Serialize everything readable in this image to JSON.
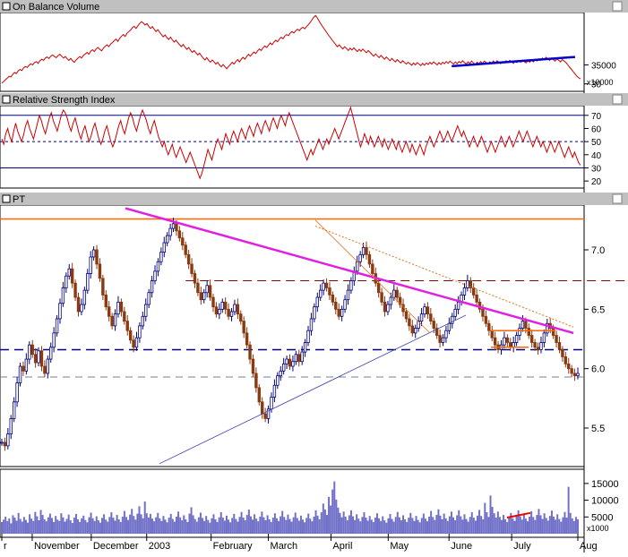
{
  "panels": {
    "obv": {
      "title": "On Balance Volume",
      "ticks": [
        {
          "v": 35000,
          "label": "35000"
        },
        {
          "v": 30000,
          "label": "30"
        }
      ],
      "scale_label": "x10000"
    },
    "rsi": {
      "title": "Relative Strength Index",
      "ticks": [
        {
          "v": 70,
          "label": "70"
        },
        {
          "v": 60,
          "label": "60"
        },
        {
          "v": 50,
          "label": "50"
        },
        {
          "v": 40,
          "label": "40"
        },
        {
          "v": 30,
          "label": "30"
        },
        {
          "v": 20,
          "label": "20"
        }
      ]
    },
    "price": {
      "title": "PT",
      "ticks": [
        {
          "v": 7.0,
          "label": "7.0"
        },
        {
          "v": 6.5,
          "label": "6.5"
        },
        {
          "v": 6.0,
          "label": "6.0"
        },
        {
          "v": 5.5,
          "label": "5.5"
        }
      ]
    },
    "volume": {
      "ticks": [
        {
          "v": 15000,
          "label": "15000"
        },
        {
          "v": 10000,
          "label": "10000"
        },
        {
          "v": 5000,
          "label": "5000"
        }
      ],
      "scale_label": "x1000"
    }
  },
  "x_axis": {
    "labels": [
      {
        "text": "r",
        "i": 0
      },
      {
        "text": "November",
        "i": 17
      },
      {
        "text": "December",
        "i": 50
      },
      {
        "text": "2003",
        "i": 81
      },
      {
        "text": "February",
        "i": 117
      },
      {
        "text": "March",
        "i": 149
      },
      {
        "text": "April",
        "i": 184
      },
      {
        "text": "May",
        "i": 216
      },
      {
        "text": "June",
        "i": 250
      },
      {
        "text": "July",
        "i": 285
      },
      {
        "text": "Aug",
        "i": 322
      }
    ]
  },
  "chart_data": {
    "type": "line",
    "series": [
      {
        "name": "On Balance Volume",
        "values": [
          30.2,
          30.6,
          31.1,
          31.5,
          32.0,
          31.8,
          32.5,
          33.0,
          32.7,
          33.4,
          33.8,
          33.5,
          34.2,
          34.6,
          34.3,
          34.9,
          35.3,
          35.0,
          35.6,
          35.9,
          35.4,
          36.1,
          36.5,
          36.2,
          36.8,
          37.1,
          36.7,
          37.3,
          37.6,
          37.2,
          36.9,
          37.4,
          37.8,
          37.3,
          36.8,
          37.2,
          36.6,
          36.2,
          36.7,
          36.1,
          35.7,
          36.3,
          36.8,
          37.2,
          36.8,
          37.5,
          37.9,
          38.3,
          37.8,
          38.6,
          39.0,
          38.5,
          39.2,
          39.6,
          39.1,
          38.7,
          39.4,
          39.9,
          40.3,
          39.8,
          40.5,
          40.9,
          41.4,
          41.8,
          41.2,
          42.0,
          42.6,
          43.0,
          42.5,
          43.3,
          43.8,
          44.2,
          44.8,
          45.2,
          44.6,
          45.3,
          45.9,
          46.4,
          46.0,
          45.5,
          45.9,
          45.2,
          44.6,
          45.1,
          44.4,
          43.8,
          44.3,
          43.6,
          43.0,
          42.4,
          42.9,
          42.2,
          41.7,
          42.3,
          41.6,
          41.0,
          41.5,
          40.9,
          40.3,
          39.8,
          40.4,
          39.7,
          39.1,
          39.6,
          38.9,
          38.3,
          38.8,
          38.2,
          37.6,
          38.1,
          37.4,
          36.8,
          36.3,
          36.9,
          36.2,
          35.7,
          36.3,
          35.8,
          35.2,
          35.7,
          35.0,
          34.5,
          35.1,
          34.5,
          34.0,
          34.6,
          35.1,
          35.7,
          35.2,
          35.9,
          36.4,
          35.8,
          36.5,
          37.0,
          36.5,
          37.2,
          37.8,
          37.3,
          37.9,
          38.4,
          38.0,
          38.7,
          39.2,
          38.8,
          39.5,
          40.0,
          39.6,
          40.2,
          40.8,
          40.3,
          41.0,
          41.5,
          41.1,
          41.8,
          42.3,
          41.9,
          42.6,
          43.0,
          42.7,
          43.4,
          43.8,
          43.4,
          44.0,
          44.4,
          44.0,
          44.6,
          44.9,
          44.5,
          45.1,
          45.6,
          46.2,
          46.9,
          47.6,
          48.0,
          47.3,
          46.5,
          45.7,
          45.0,
          44.3,
          43.6,
          42.9,
          42.3,
          41.6,
          41.0,
          40.4,
          39.8,
          40.3,
          39.7,
          39.2,
          39.8,
          39.3,
          38.8,
          39.4,
          38.9,
          39.5,
          39.0,
          38.5,
          39.1,
          38.6,
          39.2,
          38.7,
          38.2,
          38.8,
          38.3,
          37.8,
          37.3,
          37.9,
          37.4,
          36.9,
          37.5,
          37.0,
          36.5,
          37.1,
          36.6,
          36.1,
          36.7,
          36.2,
          35.8,
          36.4,
          35.9,
          35.5,
          36.1,
          35.6,
          35.2,
          35.7,
          35.3,
          34.9,
          35.5,
          35.0,
          35.6,
          35.2,
          34.8,
          35.4,
          34.9,
          35.5,
          35.1,
          35.7,
          35.2,
          35.8,
          35.4,
          35.0,
          35.6,
          35.1,
          35.7,
          35.3,
          35.9,
          35.4,
          36.0,
          35.6,
          35.2,
          35.8,
          35.3,
          35.9,
          35.5,
          36.1,
          35.6,
          35.2,
          35.8,
          35.4,
          36.0,
          35.5,
          35.1,
          35.7,
          35.3,
          35.9,
          35.4,
          36.0,
          35.6,
          35.2,
          35.8,
          35.4,
          36.0,
          35.5,
          36.1,
          35.7,
          35.3,
          35.9,
          35.5,
          36.1,
          35.6,
          36.2,
          35.8,
          35.4,
          36.0,
          35.6,
          36.2,
          35.7,
          36.3,
          35.9,
          35.5,
          36.1,
          35.7,
          36.3,
          35.8,
          36.4,
          36.0,
          36.6,
          36.2,
          36.8,
          36.4,
          37.0,
          36.6,
          36.2,
          36.8,
          36.4,
          36.0,
          36.6,
          36.2,
          35.8,
          36.4,
          36.0,
          35.6,
          35.0,
          34.4,
          33.8,
          33.2,
          32.6,
          32.0,
          31.6,
          31.3
        ]
      },
      {
        "name": "Relative Strength Index",
        "values": [
          52,
          48,
          56,
          60,
          54,
          50,
          58,
          64,
          58,
          54,
          50,
          55,
          62,
          66,
          60,
          56,
          52,
          58,
          64,
          70,
          66,
          60,
          56,
          62,
          68,
          72,
          66,
          62,
          58,
          64,
          70,
          74,
          72,
          68,
          62,
          58,
          64,
          68,
          62,
          56,
          52,
          58,
          62,
          56,
          50,
          54,
          60,
          64,
          58,
          52,
          48,
          52,
          58,
          62,
          56,
          50,
          46,
          50,
          56,
          62,
          66,
          60,
          56,
          62,
          68,
          72,
          68,
          62,
          58,
          64,
          70,
          74,
          70,
          66,
          60,
          56,
          62,
          66,
          60,
          54,
          50,
          46,
          50,
          44,
          40,
          44,
          48,
          42,
          38,
          42,
          46,
          42,
          38,
          34,
          38,
          42,
          38,
          34,
          30,
          26,
          22,
          26,
          32,
          38,
          44,
          40,
          36,
          42,
          48,
          52,
          48,
          44,
          50,
          56,
          52,
          48,
          54,
          58,
          54,
          50,
          56,
          60,
          56,
          52,
          58,
          62,
          58,
          54,
          60,
          64,
          60,
          56,
          62,
          66,
          62,
          58,
          64,
          68,
          64,
          60,
          66,
          70,
          66,
          62,
          68,
          72,
          68,
          64,
          60,
          56,
          52,
          48,
          44,
          40,
          36,
          40,
          44,
          40,
          44,
          48,
          52,
          48,
          44,
          48,
          52,
          48,
          52,
          56,
          60,
          56,
          52,
          56,
          60,
          64,
          68,
          72,
          76,
          70,
          64,
          58,
          52,
          46,
          50,
          56,
          52,
          48,
          54,
          50,
          46,
          50,
          54,
          50,
          46,
          52,
          48,
          44,
          48,
          52,
          48,
          44,
          50,
          46,
          42,
          46,
          50,
          46,
          42,
          48,
          44,
          40,
          44,
          48,
          44,
          40,
          46,
          50,
          54,
          50,
          46,
          50,
          54,
          58,
          54,
          50,
          54,
          58,
          54,
          50,
          54,
          58,
          62,
          58,
          54,
          58,
          54,
          50,
          46,
          50,
          54,
          50,
          46,
          50,
          54,
          50,
          46,
          42,
          46,
          50,
          46,
          42,
          46,
          50,
          54,
          50,
          46,
          50,
          54,
          50,
          46,
          50,
          54,
          58,
          54,
          50,
          54,
          58,
          54,
          50,
          46,
          50,
          54,
          50,
          46,
          50,
          46,
          42,
          46,
          50,
          46,
          42,
          46,
          50,
          46,
          42,
          38,
          42,
          46,
          42,
          38,
          42,
          38,
          34,
          32
        ]
      },
      {
        "name": "PT",
        "values": [
          5.38,
          5.35,
          5.45,
          5.58,
          5.72,
          5.88,
          6.02,
          5.98,
          6.08,
          6.2,
          6.12,
          6.05,
          6.15,
          6.02,
          5.96,
          6.08,
          6.18,
          6.3,
          6.42,
          6.55,
          6.68,
          6.78,
          6.84,
          6.72,
          6.6,
          6.48,
          6.54,
          6.66,
          6.8,
          6.94,
          7.0,
          6.88,
          6.76,
          6.62,
          6.52,
          6.44,
          6.36,
          6.46,
          6.56,
          6.48,
          6.4,
          6.32,
          6.24,
          6.18,
          6.26,
          6.36,
          6.44,
          6.54,
          6.64,
          6.74,
          6.82,
          6.9,
          6.98,
          7.06,
          7.12,
          7.18,
          7.22,
          7.16,
          7.1,
          7.04,
          6.96,
          6.88,
          6.8,
          6.72,
          6.64,
          6.58,
          6.64,
          6.7,
          6.6,
          6.52,
          6.46,
          6.5,
          6.56,
          6.5,
          6.44,
          6.48,
          6.54,
          6.46,
          6.4,
          6.3,
          6.2,
          6.08,
          5.96,
          5.84,
          5.72,
          5.62,
          5.58,
          5.66,
          5.76,
          5.86,
          5.94,
          5.98,
          6.04,
          6.08,
          6.02,
          6.06,
          6.12,
          6.06,
          6.14,
          6.22,
          6.32,
          6.42,
          6.52,
          6.6,
          6.66,
          6.72,
          6.68,
          6.62,
          6.56,
          6.5,
          6.44,
          6.5,
          6.58,
          6.66,
          6.74,
          6.82,
          6.9,
          6.96,
          7.02,
          6.96,
          6.88,
          6.8,
          6.72,
          6.64,
          6.56,
          6.48,
          6.54,
          6.6,
          6.66,
          6.6,
          6.54,
          6.48,
          6.42,
          6.36,
          6.3,
          6.34,
          6.4,
          6.46,
          6.52,
          6.46,
          6.4,
          6.34,
          6.28,
          6.22,
          6.26,
          6.32,
          6.38,
          6.44,
          6.5,
          6.56,
          6.62,
          6.68,
          6.74,
          6.68,
          6.62,
          6.56,
          6.5,
          6.44,
          6.38,
          6.32,
          6.26,
          6.2,
          6.16,
          6.2,
          6.26,
          6.22,
          6.18,
          6.22,
          6.28,
          6.34,
          6.4,
          6.34,
          6.28,
          6.22,
          6.18,
          6.16,
          6.22,
          6.3,
          6.38,
          6.34,
          6.28,
          6.22,
          6.16,
          6.1,
          6.04,
          6.0,
          5.96,
          5.94,
          5.96
        ]
      },
      {
        "name": "Volume",
        "values": [
          3.5,
          4.2,
          5.1,
          3.8,
          4.6,
          3.1,
          5.5,
          4.8,
          3.9,
          6.2,
          4.4,
          3.6,
          5.0,
          4.1,
          3.3,
          5.8,
          4.5,
          3.8,
          6.5,
          5.2,
          4.0,
          7.1,
          5.6,
          4.3,
          3.7,
          4.9,
          6.0,
          4.7,
          3.5,
          5.3,
          4.2,
          3.8,
          6.1,
          4.9,
          3.6,
          4.4,
          5.7,
          4.0,
          3.2,
          4.8,
          5.9,
          4.3,
          3.5,
          4.6,
          5.4,
          4.1,
          3.4,
          4.9,
          6.3,
          4.6,
          3.8,
          5.2,
          4.0,
          3.3,
          4.7,
          5.8,
          4.2,
          3.6,
          5.0,
          6.4,
          4.8,
          3.9,
          5.6,
          4.3,
          3.5,
          5.1,
          6.8,
          5.0,
          4.1,
          5.7,
          7.4,
          5.3,
          4.2,
          6.0,
          8.2,
          5.8,
          4.6,
          9.6,
          6.1,
          4.8,
          5.9,
          4.5,
          3.7,
          4.9,
          6.2,
          4.6,
          3.8,
          5.3,
          4.2,
          3.4,
          4.8,
          5.9,
          4.4,
          3.6,
          5.1,
          6.6,
          4.9,
          4.0,
          5.5,
          4.3,
          3.5,
          6.0,
          7.9,
          5.5,
          4.4,
          3.6,
          4.9,
          6.3,
          4.7,
          3.8,
          5.3,
          4.1,
          3.3,
          4.6,
          5.8,
          4.3,
          3.5,
          4.9,
          6.4,
          4.8,
          3.9,
          5.4,
          4.2,
          3.4,
          4.7,
          5.9,
          4.4,
          3.6,
          5.0,
          6.5,
          4.8,
          4.0,
          5.6,
          7.2,
          5.2,
          4.2,
          5.8,
          4.5,
          3.7,
          5.1,
          6.6,
          4.9,
          4.0,
          5.5,
          4.3,
          3.5,
          4.8,
          6.1,
          4.6,
          3.8,
          5.2,
          6.8,
          5.0,
          4.1,
          5.7,
          4.4,
          3.6,
          4.9,
          6.3,
          4.7,
          3.9,
          5.4,
          4.2,
          3.4,
          4.7,
          6.0,
          4.5,
          3.7,
          5.1,
          7.0,
          5.4,
          4.3,
          6.4,
          9.0,
          7.2,
          5.6,
          11.0,
          8.4,
          13.2,
          15.6,
          10.2,
          7.8,
          6.2,
          4.9,
          6.6,
          5.1,
          4.0,
          5.5,
          7.0,
          5.2,
          4.1,
          5.8,
          4.5,
          3.7,
          5.0,
          6.4,
          4.8,
          3.9,
          5.3,
          4.2,
          3.5,
          4.8,
          6.1,
          4.6,
          3.8,
          5.2,
          4.0,
          3.3,
          4.6,
          5.9,
          4.4,
          3.6,
          5.0,
          6.5,
          4.9,
          4.0,
          5.5,
          4.3,
          3.5,
          4.8,
          6.2,
          4.7,
          3.8,
          5.3,
          4.1,
          3.4,
          4.7,
          6.0,
          4.5,
          3.7,
          5.1,
          6.8,
          5.0,
          4.1,
          5.6,
          7.3,
          5.4,
          4.3,
          6.0,
          4.6,
          3.8,
          5.2,
          6.6,
          4.9,
          4.0,
          5.5,
          7.0,
          5.2,
          4.2,
          5.8,
          4.4,
          3.6,
          5.0,
          6.4,
          4.8,
          3.9,
          5.4,
          7.1,
          5.3,
          4.3,
          9.2,
          6.4,
          5.0,
          11.4,
          8.0,
          6.1,
          4.8,
          6.6,
          5.0,
          4.1,
          5.6,
          4.3,
          3.5,
          4.8,
          6.2,
          4.6,
          3.8,
          5.3,
          7.0,
          5.2,
          4.2,
          5.9,
          4.5,
          3.7,
          5.1,
          6.7,
          5.0,
          4.1,
          5.6,
          7.4,
          5.5,
          4.4,
          6.1,
          4.7,
          3.9,
          5.3,
          6.9,
          5.1,
          4.2,
          5.8,
          4.4,
          3.6,
          4.9,
          6.5,
          4.8,
          14.0,
          6.2,
          4.6,
          3.8,
          5.0,
          4.3
        ]
      }
    ]
  }
}
